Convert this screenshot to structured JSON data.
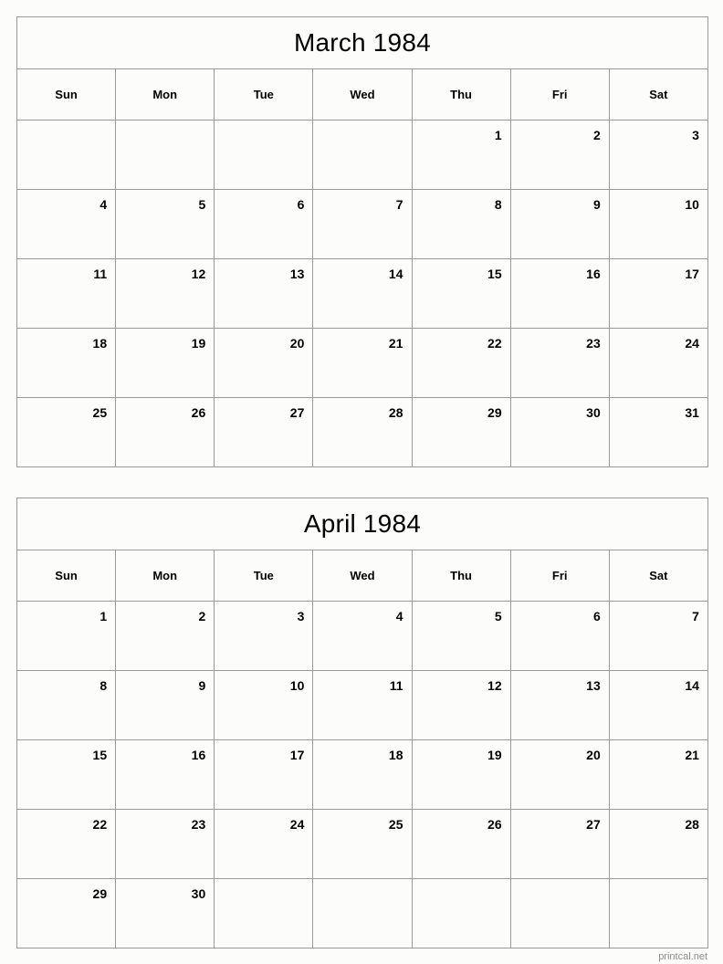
{
  "page": {
    "background_color": "#fcfdfa",
    "border_color": "#999999",
    "text_color": "#000000"
  },
  "footer": {
    "label": "printcal.net",
    "color": "#8c8c8c"
  },
  "calendars": [
    {
      "id": "march-1984",
      "title": "March 1984",
      "month": "March",
      "year": "1984",
      "weekdays": [
        "Sun",
        "Mon",
        "Tue",
        "Wed",
        "Thu",
        "Fri",
        "Sat"
      ],
      "weeks": [
        [
          "",
          "",
          "",
          "",
          "1",
          "2",
          "3"
        ],
        [
          "4",
          "5",
          "6",
          "7",
          "8",
          "9",
          "10"
        ],
        [
          "11",
          "12",
          "13",
          "14",
          "15",
          "16",
          "17"
        ],
        [
          "18",
          "19",
          "20",
          "21",
          "22",
          "23",
          "24"
        ],
        [
          "25",
          "26",
          "27",
          "28",
          "29",
          "30",
          "31"
        ]
      ]
    },
    {
      "id": "april-1984",
      "title": "April 1984",
      "month": "April",
      "year": "1984",
      "weekdays": [
        "Sun",
        "Mon",
        "Tue",
        "Wed",
        "Thu",
        "Fri",
        "Sat"
      ],
      "weeks": [
        [
          "1",
          "2",
          "3",
          "4",
          "5",
          "6",
          "7"
        ],
        [
          "8",
          "9",
          "10",
          "11",
          "12",
          "13",
          "14"
        ],
        [
          "15",
          "16",
          "17",
          "18",
          "19",
          "20",
          "21"
        ],
        [
          "22",
          "23",
          "24",
          "25",
          "26",
          "27",
          "28"
        ],
        [
          "29",
          "30",
          "",
          "",
          "",
          "",
          ""
        ]
      ]
    }
  ]
}
